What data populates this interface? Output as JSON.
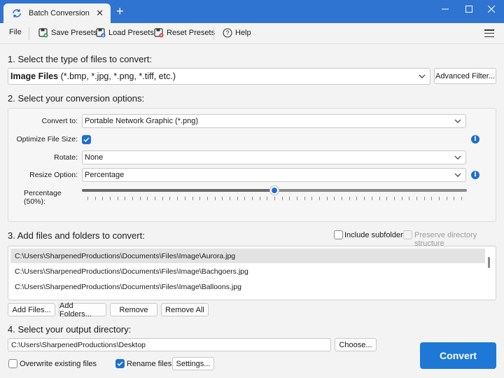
{
  "window": {
    "tab_title": "Batch Conversion",
    "tab_icon": "refresh-icon",
    "new_tab": "+",
    "controls": [
      "minimize-icon",
      "maximize-icon",
      "close-icon"
    ],
    "accent_color": "#2f74d0"
  },
  "toolbar": {
    "file": "File",
    "save_presets": "Save Presets",
    "load_presets": "Load Presets",
    "reset_presets": "Reset Presets",
    "help": "Help",
    "menu_icon": "hamburger-icon"
  },
  "section1": {
    "title": "1. Select the type of files to convert:",
    "file_type_bold": "Image Files",
    "file_type_rest": " (*.bmp, *.jpg, *.png, *.tiff, etc.)",
    "advanced_filter": "Advanced Filter..."
  },
  "section2": {
    "title": "2. Select your conversion options:",
    "convert_to_label": "Convert to:",
    "convert_to_value": "Portable Network Graphic (*.png)",
    "optimize_label": "Optimize File Size:",
    "optimize_checked": true,
    "rotate_label": "Rotate:",
    "rotate_value": "None",
    "resize_label": "Resize Option:",
    "resize_value": "Percentage",
    "percentage_label": "Percentage (50%):",
    "percentage_value": 50
  },
  "section3": {
    "title": "3. Add files and folders to convert:",
    "include_subfolders": "Include subfolders",
    "include_subfolders_checked": false,
    "preserve_structure": "Preserve directory structure",
    "preserve_structure_enabled": false,
    "files": [
      "C:\\Users\\SharpenedProductions\\Documents\\Files\\Image\\Aurora.jpg",
      "C:\\Users\\SharpenedProductions\\Documents\\Files\\Image\\Bachgoers.jpg",
      "C:\\Users\\SharpenedProductions\\Documents\\Files\\Image\\Balloons.jpg"
    ],
    "add_files": "Add Files...",
    "add_folders": "Add Folders...",
    "remove": "Remove",
    "remove_all": "Remove All"
  },
  "section4": {
    "title": "4. Select your output directory:",
    "output_path": "C:\\Users\\SharpenedProductions\\Desktop",
    "choose": "Choose...",
    "overwrite": "Overwrite existing files",
    "overwrite_checked": false,
    "rename": "Rename files",
    "rename_checked": true,
    "settings": "Settings..."
  },
  "convert_button": "Convert"
}
